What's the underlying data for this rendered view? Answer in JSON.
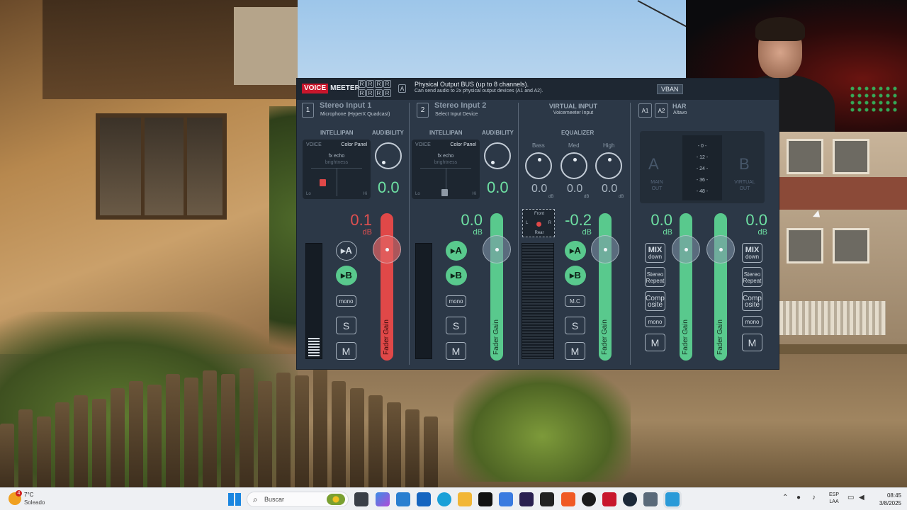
{
  "colors": {
    "accent_green": "#59c98d",
    "accent_red": "#e04848",
    "panel": "#2c3847",
    "brand_red": "#c8162c"
  },
  "header": {
    "logo_a": "VOICE",
    "logo_b": "MEETER",
    "r_buttons": [
      "R",
      "R",
      "R",
      "R",
      "R",
      "R",
      "R",
      "R"
    ],
    "a_label": "A",
    "bus_title": "Physical Output BUS (up to 8 channels).",
    "bus_sub": "Can send audio to 2x physical output devices (A1 and A2).",
    "vban": "VBAN"
  },
  "strips": {
    "s1": {
      "num": "1",
      "name": "Stereo Input 1",
      "device": "Microphone (HyperX Quadcast)",
      "intellipan": "INTELLIPAN",
      "audibility": "AUDIBILITY",
      "aud_value": "0.0",
      "voice": "VOICE",
      "color_panel": "Color Panel",
      "fx_echo": "fx echo",
      "brightness": "brightness",
      "lo": "Lo",
      "hi": "Hi",
      "db": "0.1",
      "db_unit": "dB",
      "a": "▸A",
      "b": "▸B",
      "mono": "mono",
      "s": "S",
      "m": "M",
      "fader": "Fader Gain",
      "meter_level": 0.18
    },
    "s2": {
      "num": "2",
      "name": "Stereo Input 2",
      "device": "Select Input Device",
      "intellipan": "INTELLIPAN",
      "audibility": "AUDIBILITY",
      "aud_value": "0.0",
      "voice": "VOICE",
      "color_panel": "Color Panel",
      "fx_echo": "fx echo",
      "brightness": "brightness",
      "lo": "Lo",
      "hi": "Hi",
      "db": "0.0",
      "db_unit": "dB",
      "a": "▸A",
      "b": "▸B",
      "mono": "mono",
      "s": "S",
      "m": "M",
      "fader": "Fader Gain",
      "meter_level": 0.0
    },
    "v": {
      "title": "VIRTUAL INPUT",
      "device": "Voicemeeter Input",
      "equalizer": "EQUALIZER",
      "bass": "Bass",
      "med": "Med",
      "high": "High",
      "bass_val": "0.0",
      "med_val": "0.0",
      "high_val": "0.0",
      "eq_unit": "dB",
      "front": "Front",
      "rear": "Rear",
      "l": "L",
      "r": "R",
      "db": "-0.2",
      "db_unit": "dB",
      "a": "▸A",
      "b": "▸B",
      "mc": "M.C",
      "s": "S",
      "m": "M",
      "fader": "Fader Gain"
    }
  },
  "hw": {
    "a1": "A1",
    "a2": "A2",
    "title": "HAR",
    "device": "Altavo"
  },
  "output": {
    "scale": [
      "- 0 -",
      "- 12 -",
      "- 24 -",
      "- 36 -",
      "- 48 -"
    ],
    "a_letter": "A",
    "a_label1": "MAIN",
    "a_label2": "OUT",
    "b_letter": "B",
    "b_label1": "VIRTUAL",
    "b_label2": "OUT"
  },
  "bus_a": {
    "db": "0.0",
    "db_unit": "dB",
    "mix1": "MIX",
    "mix2": "down",
    "sr1": "Stereo",
    "sr2": "Repeat",
    "co1": "Comp",
    "co2": "osite",
    "mono": "mono",
    "m": "M",
    "fader": "Fader Gain"
  },
  "bus_b": {
    "db": "0.0",
    "db_unit": "dB",
    "mix1": "MIX",
    "mix2": "down",
    "sr1": "Stereo",
    "sr2": "Repeat",
    "co1": "Comp",
    "co2": "osite",
    "mono": "mono",
    "m": "M",
    "fader": "Fader Gain"
  },
  "taskbar": {
    "weather_badge": "4",
    "temp": "7°C",
    "condition": "Soleado",
    "search_placeholder": "Buscar",
    "lang1": "ESP",
    "lang2": "LAA",
    "time": "08:45",
    "date": "3/8/2025"
  }
}
